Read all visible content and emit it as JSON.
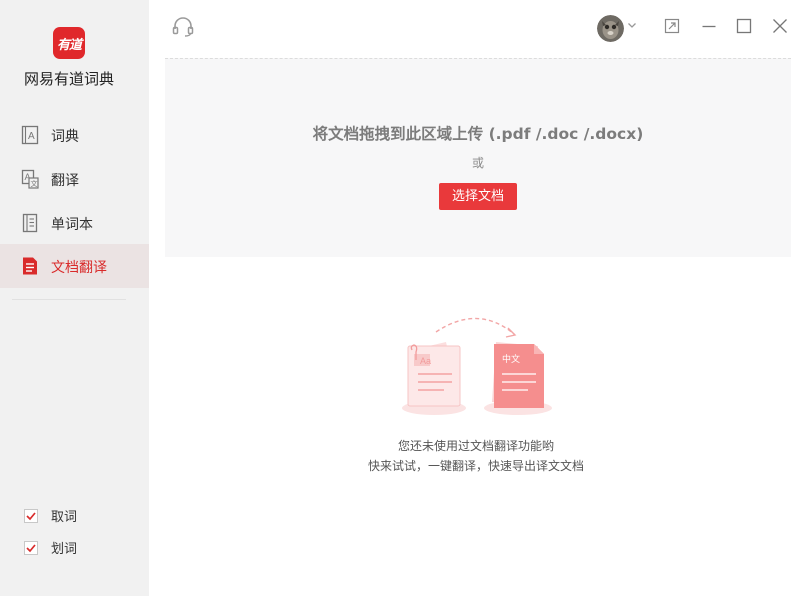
{
  "app": {
    "logo_text": "有道",
    "name": "网易有道词典"
  },
  "sidebar": {
    "items": [
      {
        "label": "词典",
        "icon": "dictionary-icon",
        "active": false
      },
      {
        "label": "翻译",
        "icon": "translate-icon",
        "active": false
      },
      {
        "label": "单词本",
        "icon": "wordbook-icon",
        "active": false
      },
      {
        "label": "文档翻译",
        "icon": "document-icon",
        "active": true
      }
    ],
    "options": [
      {
        "label": "取词",
        "checked": true
      },
      {
        "label": "划词",
        "checked": true
      }
    ]
  },
  "upload": {
    "title": "将文档拖拽到此区域上传 (.pdf /.doc /.docx)",
    "or_text": "或",
    "button_label": "选择文档"
  },
  "empty_state": {
    "line1": "您还未使用过文档翻译功能哟",
    "line2": "快来试试，一键翻译，快速导出译文文档",
    "illustration_tag": "中文",
    "illustration_source_tag": "Aa"
  },
  "colors": {
    "accent": "#e9393b",
    "sidebar_bg": "#f1f1f1",
    "active_bg": "#ebe3e3",
    "dropzone_bg": "#f7f7f8"
  }
}
